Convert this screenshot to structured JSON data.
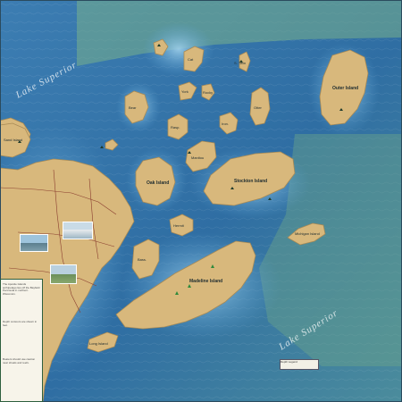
{
  "map": {
    "lake_label_north": "Lake Superior",
    "lake_label_south": "Lake Superior",
    "islands": [
      {
        "id": "outer",
        "name": "Outer Island"
      },
      {
        "id": "stockton",
        "name": "Stockton Island"
      },
      {
        "id": "oak",
        "name": "Oak Island"
      },
      {
        "id": "sand",
        "name": "Sand Island"
      },
      {
        "id": "madeline",
        "name": "Madeline Island"
      },
      {
        "id": "michigan",
        "name": "Michigan Island"
      },
      {
        "id": "bear",
        "name": "Bear"
      },
      {
        "id": "otter",
        "name": "Otter"
      },
      {
        "id": "raspberry",
        "name": "Rasp."
      },
      {
        "id": "ironwood",
        "name": "Iron."
      },
      {
        "id": "manitou",
        "name": "Manitou"
      },
      {
        "id": "hermit",
        "name": "Hermit"
      },
      {
        "id": "basswood",
        "name": "Bass."
      },
      {
        "id": "cat",
        "name": "Cat"
      },
      {
        "id": "york",
        "name": "York"
      },
      {
        "id": "rocky",
        "name": "Rocky"
      },
      {
        "id": "south-twin",
        "name": "S. Twin"
      },
      {
        "id": "long",
        "name": "Long Island"
      }
    ],
    "colors": {
      "deep_water": "#2f6ea3",
      "mid_water": "#4f93c4",
      "shallow_water": "#8cc3e2",
      "land": "#d8b87c",
      "land_edge": "#a88a55",
      "green_tint": "#7fb58e"
    }
  },
  "panel": {
    "text_blocks": [
      "The Apostle Islands archipelago lies off the Bayfield Peninsula in northern Wisconsin.",
      "Depth contours are shown in feet.",
      "Boaters should use caution near shoals and reefs."
    ]
  },
  "inset": {
    "label": "Depth Legend"
  }
}
